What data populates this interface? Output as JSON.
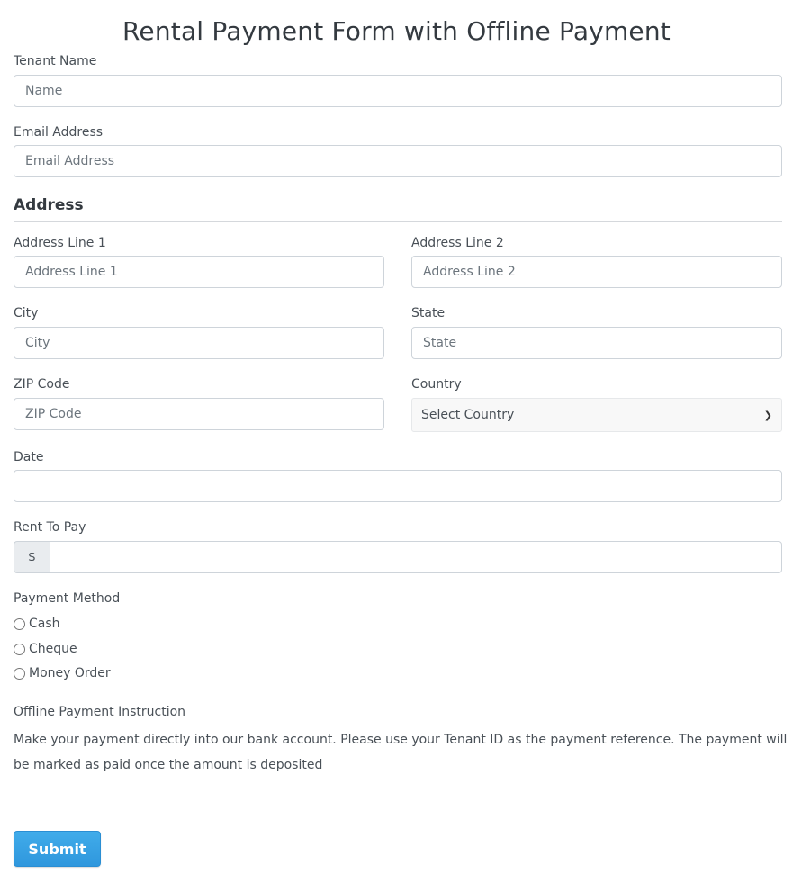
{
  "page": {
    "title": "Rental Payment Form with Offline Payment"
  },
  "tenant_name": {
    "label": "Tenant Name",
    "placeholder": "Name",
    "value": ""
  },
  "email": {
    "label": "Email Address",
    "placeholder": "Email Address",
    "value": ""
  },
  "address": {
    "section_title": "Address",
    "line1": {
      "label": "Address Line 1",
      "placeholder": "Address Line 1"
    },
    "line2": {
      "label": "Address Line 2",
      "placeholder": "Address Line 2"
    },
    "city": {
      "label": "City",
      "placeholder": "City"
    },
    "state": {
      "label": "State",
      "placeholder": "State"
    },
    "zip": {
      "label": "ZIP Code",
      "placeholder": "ZIP Code"
    },
    "country": {
      "label": "Country",
      "selected": "Select Country",
      "icon": "chevron-down-icon"
    }
  },
  "date": {
    "label": "Date",
    "value": ""
  },
  "rent": {
    "label": "Rent To Pay",
    "prefix": "$",
    "value": ""
  },
  "payment_method": {
    "label": "Payment Method",
    "options": [
      {
        "label": "Cash",
        "checked": false
      },
      {
        "label": "Cheque",
        "checked": false
      },
      {
        "label": "Money Order",
        "checked": false
      }
    ]
  },
  "instruction": {
    "label": "Offline Payment Instruction",
    "text": "Make your payment directly into our bank account. Please use your Tenant ID as the payment reference. The payment will be marked as paid once the amount is deposited"
  },
  "submit": {
    "label": "Submit",
    "color": "#3aa3e6"
  }
}
